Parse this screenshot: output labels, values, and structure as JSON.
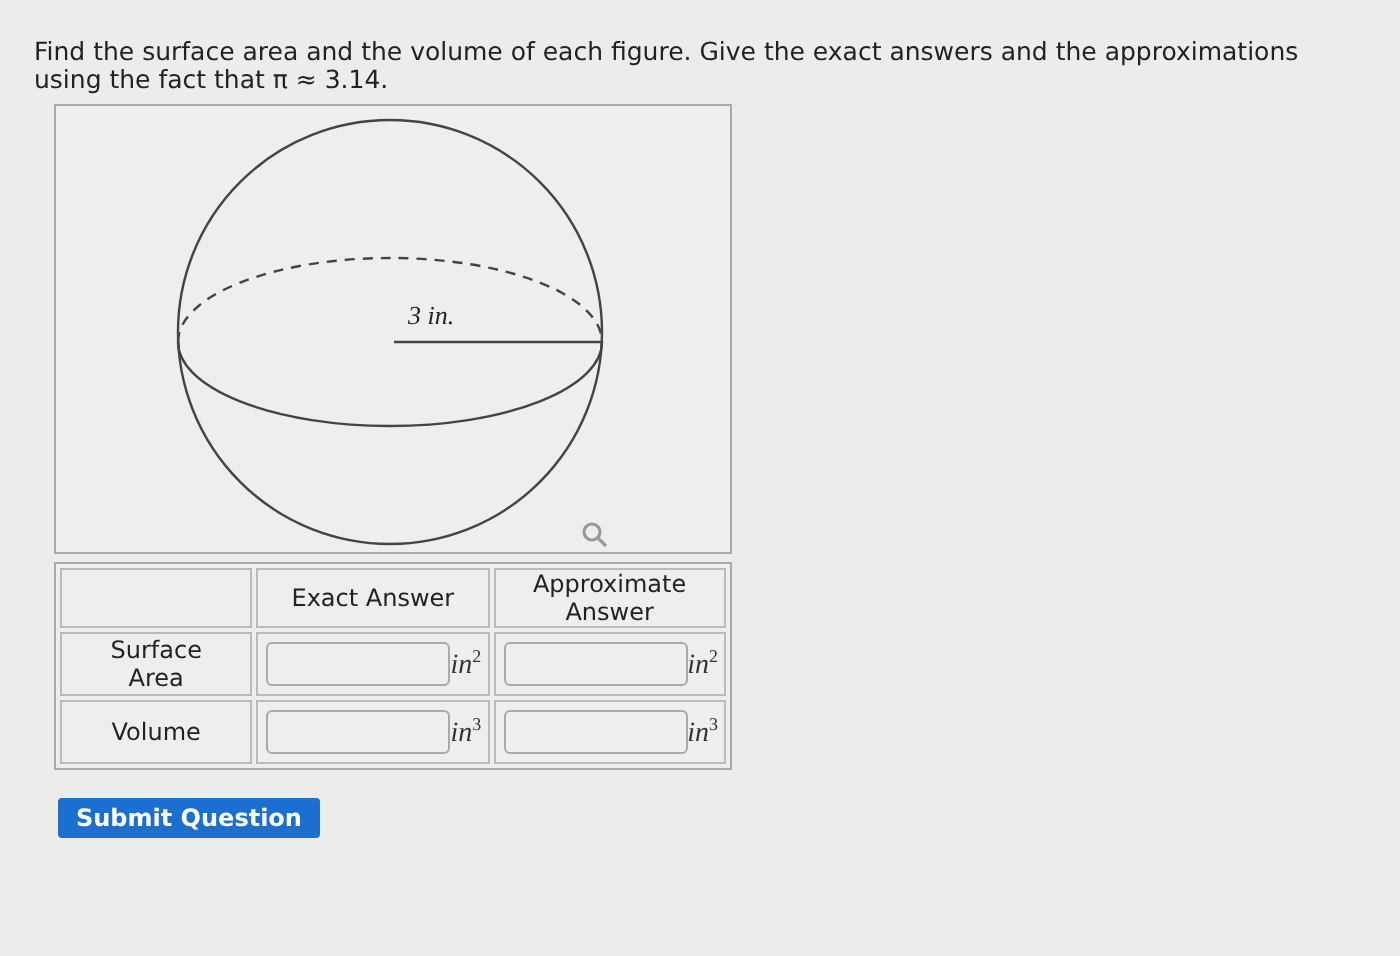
{
  "instructions": "Find the surface area and the volume of each figure. Give the exact answers and the approximations using the fact that π ≈ 3.14.",
  "figure": {
    "radius_label": "3 in."
  },
  "table": {
    "columns": [
      "Exact Answer",
      "Approximate Answer"
    ],
    "rows": [
      {
        "label": "Surface Area",
        "cells": [
          {
            "unit": "in$^{2}$"
          },
          {
            "unit": "in$^{2}$"
          }
        ]
      },
      {
        "label": "Volume",
        "cells": [
          {
            "unit": "in$^{3}$"
          },
          {
            "unit": "in$^{3}$"
          }
        ]
      }
    ]
  },
  "submit_button": "Submit Question"
}
